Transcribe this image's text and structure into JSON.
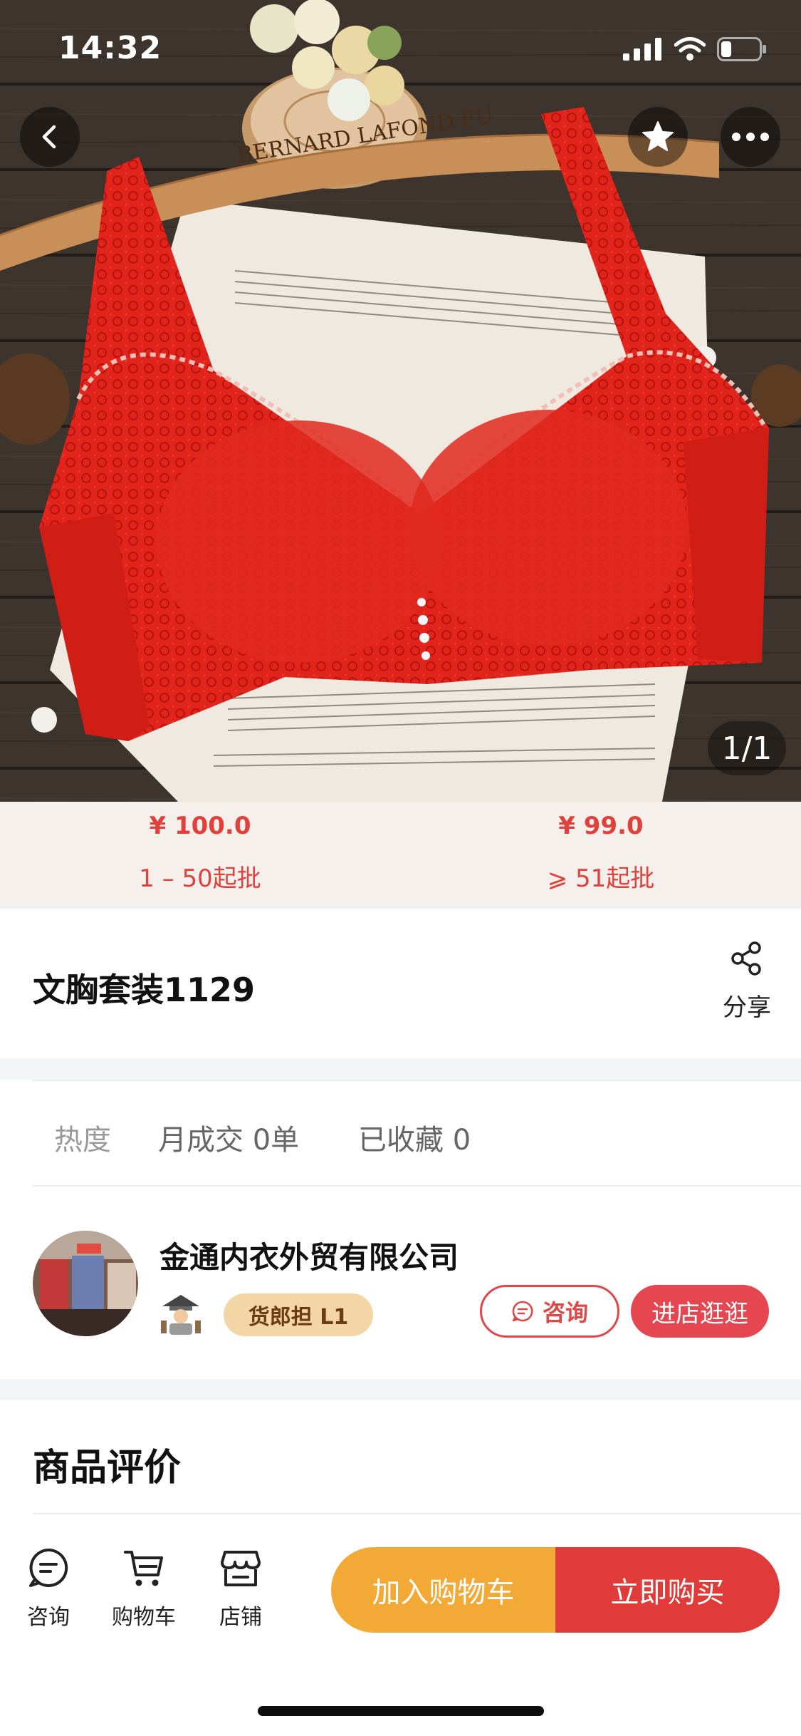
{
  "status_bar": {
    "time": "14:32"
  },
  "hero": {
    "image_counter": "1/1",
    "hanger_text": "BERNARD LAFOND FU"
  },
  "price_tiers": [
    {
      "price": "¥ 100.0",
      "quantity": "1 – 50起批"
    },
    {
      "price": "¥ 99.0",
      "quantity": "⩾ 51起批"
    }
  ],
  "product": {
    "title": "文胸套装1129",
    "share_label": "分享"
  },
  "stats": {
    "heat_label": "热度",
    "monthly_sales": "月成交 0单",
    "favorites": "已收藏 0"
  },
  "store": {
    "name": "金通内衣外贸有限公司",
    "level_badge": "货郎担 L1",
    "consult_label": "咨询",
    "visit_label": "进店逛逛"
  },
  "reviews": {
    "title": "商品评价"
  },
  "bottom_bar": {
    "nav": [
      {
        "label": "咨询",
        "icon": "chat-icon"
      },
      {
        "label": "购物车",
        "icon": "cart-icon"
      },
      {
        "label": "店铺",
        "icon": "store-icon"
      }
    ],
    "add_to_cart": "加入购物车",
    "buy_now": "立即购买"
  },
  "colors": {
    "price_red": "#e0413a",
    "cart_orange": "#f3a935",
    "buy_red": "#e03b39",
    "badge_gold": "#f4d5a6",
    "product_red": "#e1241c"
  }
}
